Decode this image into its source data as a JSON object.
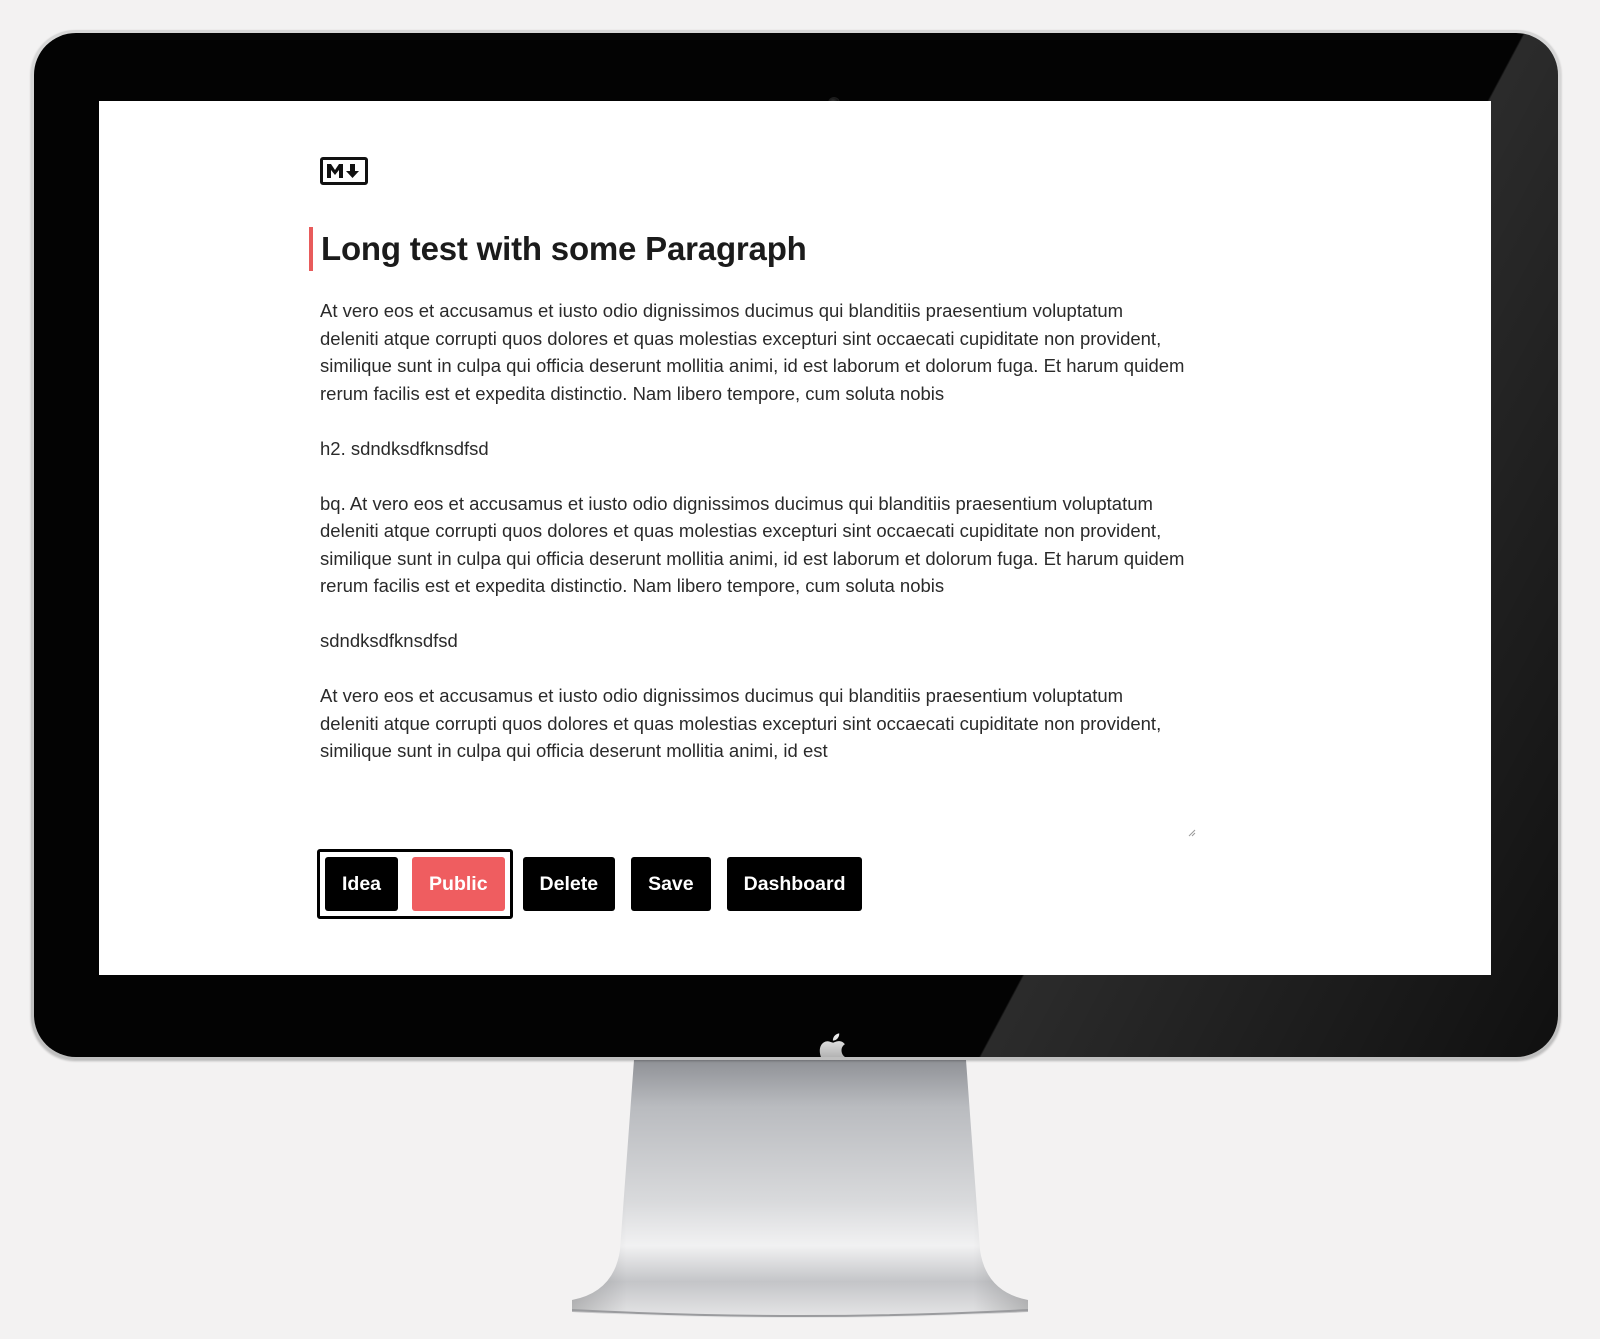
{
  "colors": {
    "accent": "#ef5d60",
    "title_accent": "#e85b5b",
    "button_bg": "#000000",
    "button_text": "#ffffff",
    "page_bg": "#f3f2f2"
  },
  "device": {
    "camera_icon": "camera-icon",
    "logo_icon": "apple-logo-icon"
  },
  "app": {
    "logo_icon": "markdown-icon"
  },
  "document": {
    "title": "Long test with some Paragraph",
    "paragraphs": [
      "At vero eos et accusamus et iusto odio dignissimos ducimus qui blanditiis praesentium voluptatum deleniti atque corrupti quos dolores et quas molestias excepturi sint occaecati cupiditate non provident, similique sunt in culpa qui officia deserunt mollitia animi, id est laborum et dolorum fuga. Et harum quidem rerum facilis est et expedita distinctio. Nam libero tempore, cum soluta nobis",
      "h2. sdndksdfknsdfsd",
      "bq. At vero eos et accusamus et iusto odio dignissimos ducimus qui blanditiis praesentium voluptatum deleniti atque corrupti quos dolores et quas molestias excepturi sint occaecati cupiditate non provident, similique sunt in culpa qui officia deserunt mollitia animi, id est laborum et dolorum fuga. Et harum quidem rerum facilis est et expedita distinctio. Nam libero tempore, cum soluta nobis",
      "sdndksdfknsdfsd",
      "At vero eos et accusamus et iusto odio dignissimos ducimus qui blanditiis praesentium voluptatum deleniti atque corrupti quos dolores et quas molestias excepturi sint occaecati cupiditate non provident, similique sunt in culpa qui officia deserunt mollitia animi, id est"
    ]
  },
  "toolbar": {
    "visibility_toggle": {
      "idea_label": "Idea",
      "public_label": "Public",
      "selected": "Public"
    },
    "delete_label": "Delete",
    "save_label": "Save",
    "dashboard_label": "Dashboard"
  }
}
